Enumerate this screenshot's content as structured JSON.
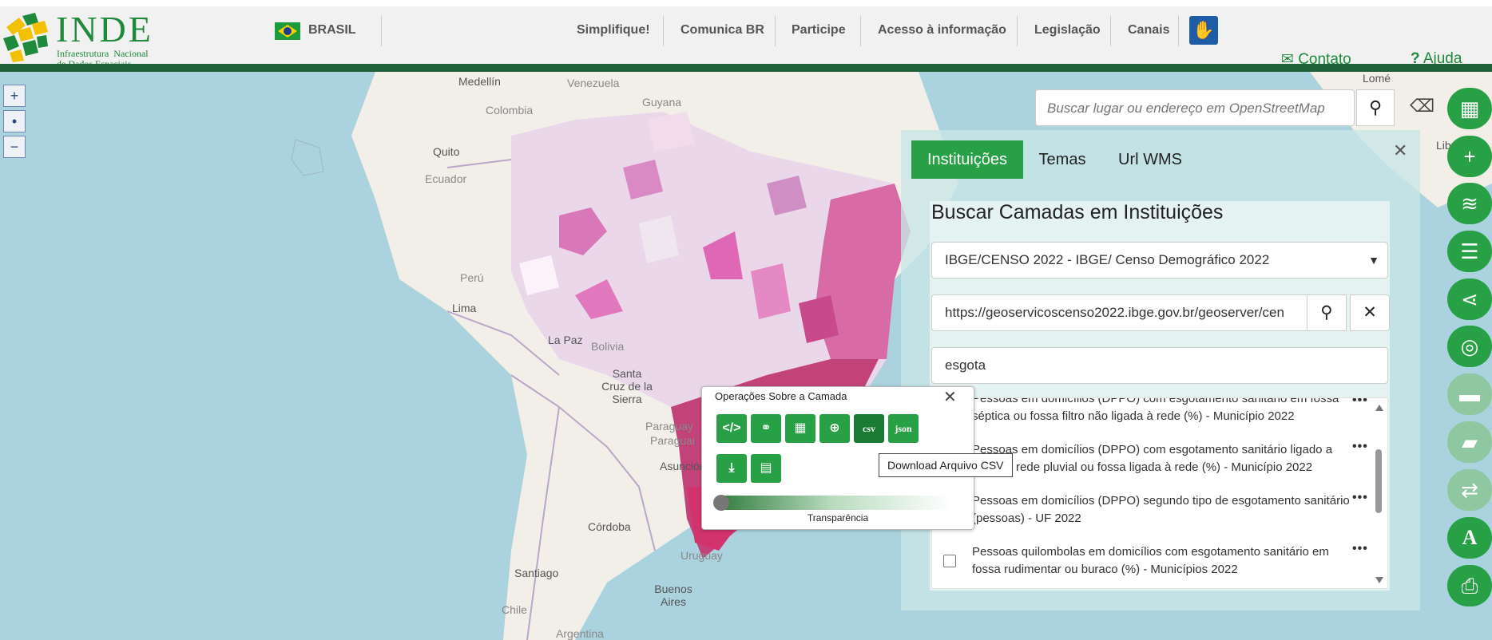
{
  "header": {
    "logo_title": "INDE",
    "logo_subtitle": "Infraestrutura  Nacional\nde Dados Espaciais",
    "country": "BRASIL",
    "nav": [
      "Simplifique!",
      "Comunica BR",
      "Participe",
      "Acesso à informação",
      "Legislação",
      "Canais"
    ],
    "contact_label": "Contato",
    "help_label": "Ajuda",
    "accessibility_icon": "sign-language-icon"
  },
  "map": {
    "zoom_in": "+",
    "zoom_reset": "•",
    "zoom_out": "−",
    "labels": [
      "Medellín",
      "Venezuela",
      "Guyana",
      "Colombia",
      "Quito",
      "Ecuador",
      "Perú",
      "Lima",
      "La Paz",
      "Bolivia",
      "Santa Cruz de la Sierra",
      "Paraguay",
      "Paraguai",
      "Asunción",
      "Córdoba",
      "Uruguay",
      "Santiago",
      "Buenos Aires",
      "Chile",
      "Argentina",
      "Lomé",
      "Libreville"
    ],
    "search_placeholder": "Buscar lugar ou endereço em OpenStreetMap"
  },
  "tools": [
    "map-icon",
    "plus-icon",
    "layers-icon",
    "list-icon",
    "share-icon",
    "globe-icon",
    "ruler-icon",
    "ruler-area-icon",
    "swap-icon",
    "font-icon",
    "print-icon"
  ],
  "panel": {
    "tabs": [
      "Instituições",
      "Temas",
      "Url WMS"
    ],
    "active_tab": "Instituições",
    "title": "Buscar Camadas em Instituições",
    "institution_select": "IBGE/CENSO 2022 - IBGE/ Censo Demográfico 2022",
    "wms_url": "https://geoservicoscenso2022.ibge.gov.br/geoserver/cen",
    "filter_value": "esgota",
    "layers": [
      {
        "label": "Pessoas em domicílios (DPPO) com esgotamento sanitário em fossa séptica ou fossa filtro não ligada à rede (%) - Município 2022",
        "checked": false
      },
      {
        "label": "Pessoas em domicílios (DPPO) com esgotamento sanitário ligado a rede ou rede pluvial ou fossa ligada à rede (%) - Município 2022",
        "checked": false
      },
      {
        "label": "Pessoas em domicílios (DPPO) segundo tipo de esgotamento sanitário (pessoas) - UF 2022",
        "checked": false
      },
      {
        "label": "Pessoas quilombolas em domicílios com esgotamento sanitário em fossa rudimentar ou buraco (%) - Municípios 2022",
        "checked": false
      }
    ],
    "more": "•••"
  },
  "layer_popup": {
    "title": "Operações Sobre a Camada",
    "csv_label": "csv",
    "json_label": "json",
    "transparency_label": "Transparência",
    "transparency": 0,
    "tooltip": "Download Arquivo CSV"
  },
  "colors": {
    "green": "#27a046",
    "dark_green": "#1f5f3a",
    "sea": "#aad3df"
  }
}
